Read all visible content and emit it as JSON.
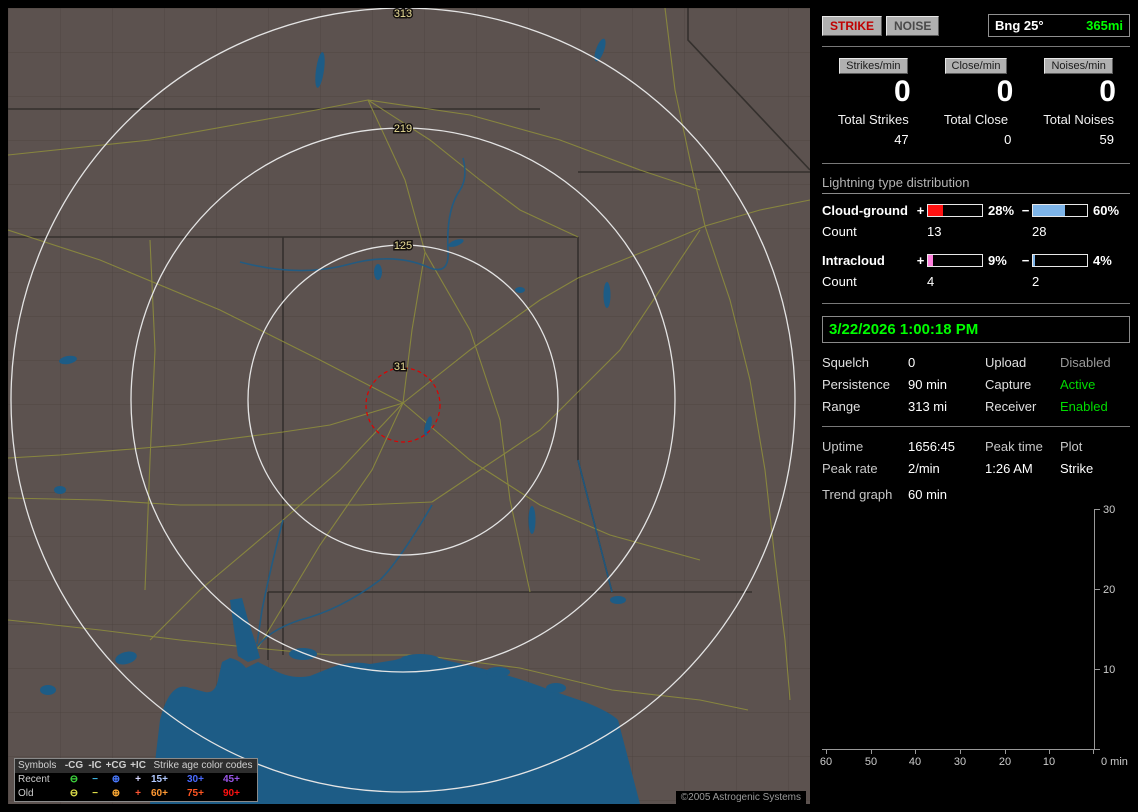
{
  "app": {
    "copyright": "©2005 Astrogenic Systems"
  },
  "header": {
    "strike_button": "STRIKE",
    "noise_button": "NOISE",
    "bearing": "Bng 25°",
    "bearing_range": "365mi"
  },
  "counters": {
    "col0": {
      "button": "Strikes/min",
      "rate": "0",
      "total_label": "Total Strikes",
      "total_value": "47"
    },
    "col1": {
      "button": "Close/min",
      "rate": "0",
      "total_label": "Total Close",
      "total_value": "0"
    },
    "col2": {
      "button": "Noises/min",
      "rate": "0",
      "total_label": "Total Noises",
      "total_value": "59"
    }
  },
  "distribution": {
    "title": "Lightning type distribution",
    "cloud_ground": {
      "label": "Cloud-ground",
      "plus_sign": "+",
      "minus_sign": "−",
      "plus_pct": 28,
      "plus_pct_label": "28%",
      "plus_color": "#ff1111",
      "minus_pct": 60,
      "minus_pct_label": "60%",
      "minus_color": "#7db4e8",
      "count_label": "Count",
      "plus_count": "13",
      "minus_count": "28"
    },
    "intracloud": {
      "label": "Intracloud",
      "plus_sign": "+",
      "minus_sign": "−",
      "plus_pct": 9,
      "plus_pct_label": "9%",
      "plus_color": "#ff80dd",
      "minus_pct": 4,
      "minus_pct_label": "4%",
      "minus_color": "#7db4e8",
      "count_label": "Count",
      "plus_count": "4",
      "minus_count": "2"
    }
  },
  "clock": {
    "datetime": "3/22/2026 1:00:18 PM"
  },
  "settings": {
    "squelch_label": "Squelch",
    "squelch_value": "0",
    "upload_label": "Upload",
    "upload_value": "Disabled",
    "upload_color": "#9a9a9a",
    "persistence_label": "Persistence",
    "persistence_value": "90 min",
    "capture_label": "Capture",
    "capture_value": "Active",
    "capture_color": "#00dd00",
    "range_label": "Range",
    "range_value": "313 mi",
    "receiver_label": "Receiver",
    "receiver_value": "Enabled",
    "receiver_color": "#00dd00"
  },
  "stats": {
    "uptime_label": "Uptime",
    "uptime_value": "1656:45",
    "peak_time_label": "Peak time",
    "peak_time_value": "1:26 AM",
    "plot_label": "Plot",
    "plot_value": "Strike",
    "peak_rate_label": "Peak rate",
    "peak_rate_value": "2/min"
  },
  "trend": {
    "label": "Trend graph",
    "window": "60 min",
    "y_ticks": [
      "30",
      "20",
      "10"
    ],
    "x_ticks": [
      "60",
      "50",
      "40",
      "30",
      "20",
      "10"
    ],
    "origin_label": "0 min"
  },
  "map": {
    "ring_labels": [
      "313",
      "219",
      "125",
      "31"
    ],
    "legend": {
      "symbols_header": "Symbols",
      "col_headers": [
        "-CG",
        "-IC",
        "+CG",
        "+IC"
      ],
      "age_header": "Strike age color codes",
      "recent": {
        "label": "Recent",
        "symbols": [
          {
            "glyph": "⊖",
            "color": "#3ed63e"
          },
          {
            "glyph": "−",
            "color": "#3eb4e0"
          },
          {
            "glyph": "⊕",
            "color": "#4a7aff"
          },
          {
            "glyph": "+",
            "color": "#d8d8ff"
          }
        ],
        "ages": [
          {
            "text": "15+",
            "color": "#b0c8ff"
          },
          {
            "text": "30+",
            "color": "#4a6aff"
          },
          {
            "text": "45+",
            "color": "#9a55e8"
          }
        ]
      },
      "old": {
        "label": "Old",
        "symbols": [
          {
            "glyph": "⊖",
            "color": "#e0e04a"
          },
          {
            "glyph": "−",
            "color": "#e0e04a"
          },
          {
            "glyph": "⊕",
            "color": "#ffaa33"
          },
          {
            "glyph": "+",
            "color": "#ff5533"
          }
        ],
        "ages": [
          {
            "text": "60+",
            "color": "#ff9933"
          },
          {
            "text": "75+",
            "color": "#ff5522"
          },
          {
            "text": "90+",
            "color": "#ff1111"
          }
        ]
      }
    }
  }
}
